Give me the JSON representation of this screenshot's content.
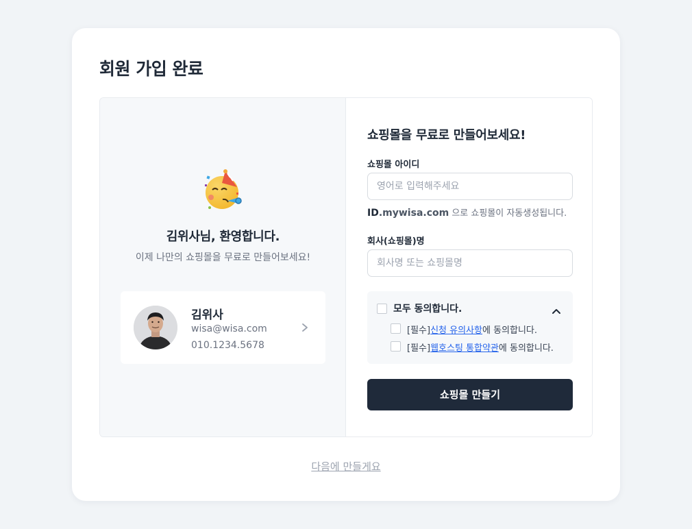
{
  "page": {
    "title": "회원 가입 완료"
  },
  "welcome": {
    "emoji_icon": "party-face-icon",
    "heading": "김위사님, 환영합니다.",
    "subtext": "이제 나만의 쇼핑몰을 무료로 만들어보세요!"
  },
  "profile": {
    "name": "김위사",
    "email": "wisa@wisa.com",
    "phone": "010.1234.5678",
    "chevron_icon": "chevron-right-icon"
  },
  "form": {
    "title": "쇼핑몰을 무료로 만들어보세요!",
    "mall_id_label": "쇼핑몰 아이디",
    "mall_id_placeholder": "영어로 입력해주세요",
    "mall_id_value": "",
    "hint_id": "ID",
    "hint_domain": ".mywisa.com",
    "hint_text": " 으로 쇼핑몰이 자동생성됩니다.",
    "company_label": "회사(쇼핑몰)명",
    "company_placeholder": "회사명 또는 쇼핑몰명",
    "company_value": ""
  },
  "agreements": {
    "all_label": "모두 동의합니다.",
    "expanded": true,
    "items": [
      {
        "prefix": "[필수]",
        "link": "신청 유의사항",
        "suffix": "에 동의합니다.",
        "checked": false
      },
      {
        "prefix": "[필수]",
        "link": "웹호스팅 통합약관",
        "suffix": "에 동의합니다.",
        "checked": false
      }
    ],
    "all_checked": false
  },
  "actions": {
    "create_label": "쇼핑몰 만들기",
    "later_label": "다음에 만들게요"
  },
  "colors": {
    "background": "#f1f4f7",
    "primary_button": "#1f2a3a",
    "link": "#2563eb"
  }
}
